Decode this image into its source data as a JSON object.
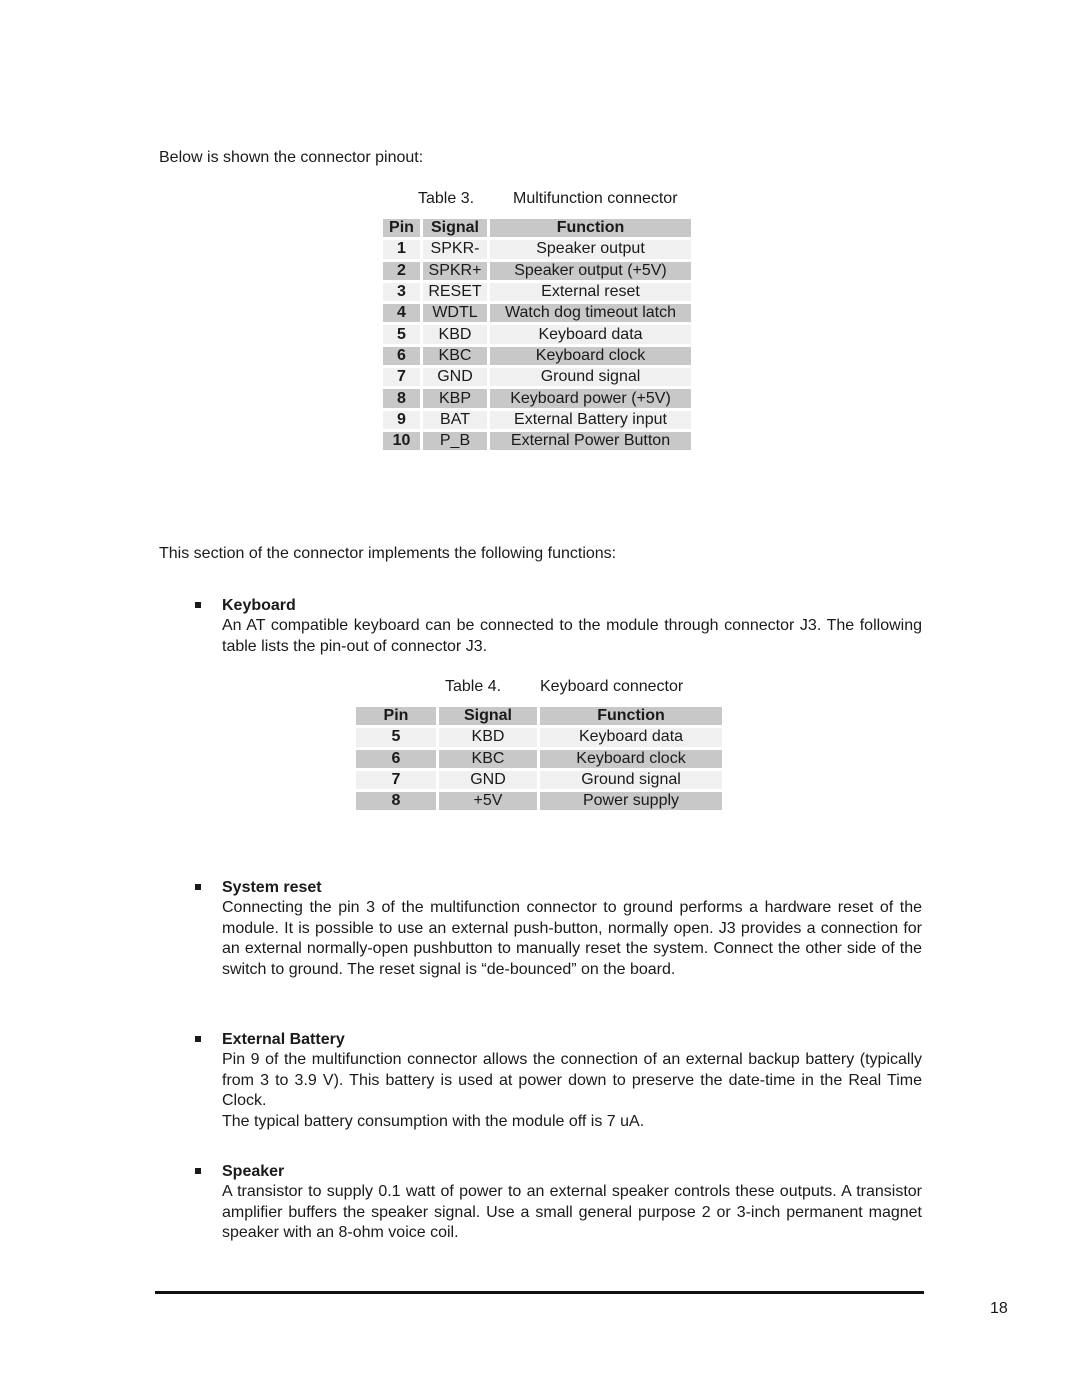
{
  "intro": "Below is shown the connector pinout:",
  "table3": {
    "number": "Table 3.",
    "title": "Multifunction connector",
    "headers": [
      "Pin",
      "Signal",
      "Function"
    ],
    "rows": [
      [
        "1",
        "SPKR-",
        "Speaker output"
      ],
      [
        "2",
        "SPKR+",
        "Speaker output (+5V)"
      ],
      [
        "3",
        "RESET",
        "External reset"
      ],
      [
        "4",
        "WDTL",
        "Watch dog timeout latch"
      ],
      [
        "5",
        "KBD",
        "Keyboard data"
      ],
      [
        "6",
        "KBC",
        "Keyboard clock"
      ],
      [
        "7",
        "GND",
        "Ground signal"
      ],
      [
        "8",
        "KBP",
        "Keyboard power (+5V)"
      ],
      [
        "9",
        "BAT",
        "External Battery input"
      ],
      [
        "10",
        "P_B",
        "External Power Button"
      ]
    ]
  },
  "section_intro": "This section of the connector implements the following functions:",
  "sections": {
    "keyboard": {
      "heading": "Keyboard",
      "body": [
        "An AT compatible keyboard can be connected to the module through connector J3. The following table lists the pin-out of connector J3."
      ]
    },
    "reset": {
      "heading": "System reset",
      "body": [
        "Connecting the pin 3 of the multifunction connector to ground performs a hardware reset of the module. It is possible to use an external push-button, normally open. J3 provides a connection for an external normally-open pushbutton to manually reset the system. Connect the other side of the switch to ground. The reset signal is “de-bounced” on the board."
      ]
    },
    "battery": {
      "heading": "External Battery",
      "body": [
        "Pin 9 of the multifunction connector allows the connection of an external backup battery (typically from 3 to 3.9 V). This battery is used at power down to preserve the date-time in the Real Time Clock.",
        "The typical battery consumption with the module off is 7 uA."
      ]
    },
    "speaker": {
      "heading": "Speaker",
      "body": [
        "A transistor to supply 0.1 watt of power to an external speaker controls these outputs. A transistor amplifier buffers the speaker signal. Use a small general purpose 2 or 3-inch permanent magnet speaker with an 8-ohm voice coil."
      ]
    }
  },
  "table4": {
    "number": "Table 4.",
    "title": "Keyboard connector",
    "headers": [
      "Pin",
      "Signal",
      "Function"
    ],
    "rows": [
      [
        "5",
        "KBD",
        "Keyboard data"
      ],
      [
        "6",
        "KBC",
        "Keyboard clock"
      ],
      [
        "7",
        "GND",
        "Ground signal"
      ],
      [
        "8",
        "+5V",
        "Power supply"
      ]
    ]
  },
  "footer": {
    "page_number": "18"
  }
}
